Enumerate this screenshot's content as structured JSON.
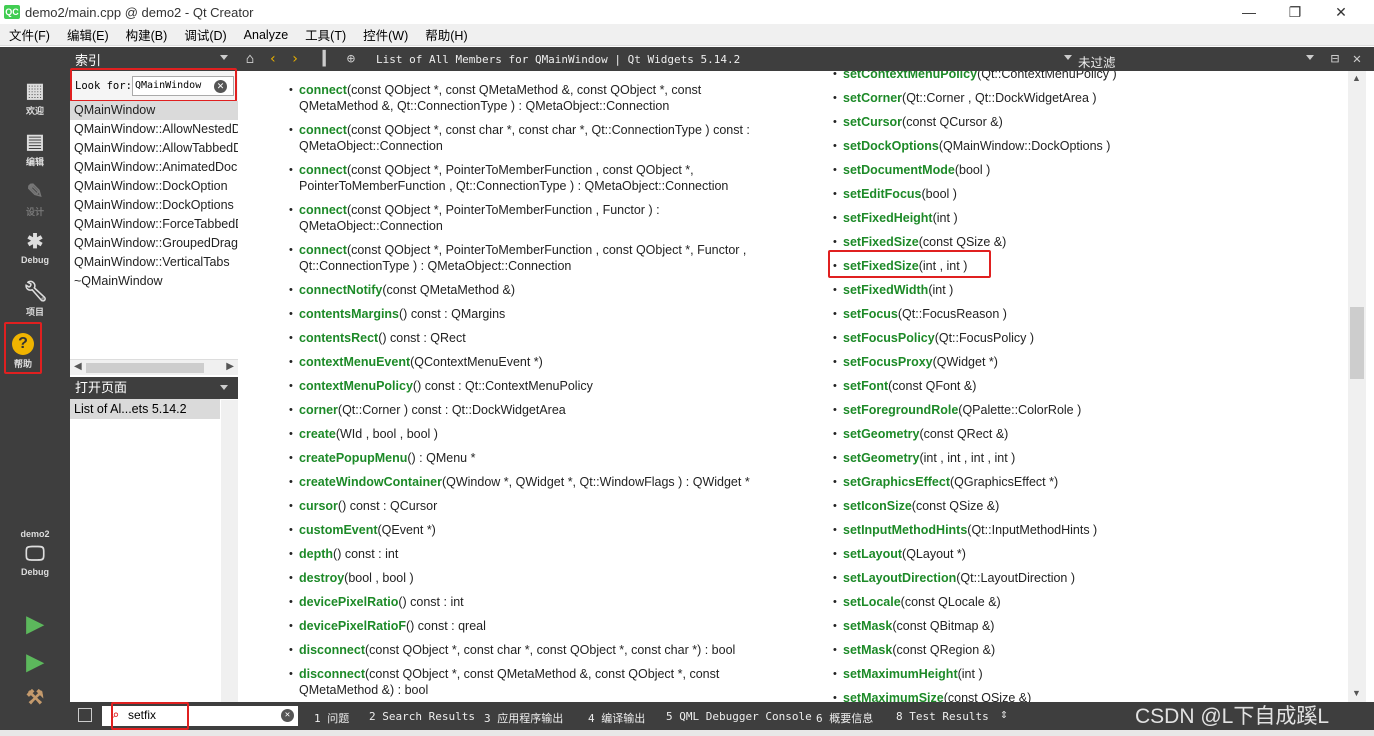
{
  "window": {
    "logo": "QC",
    "title": "demo2/main.cpp @ demo2 - Qt Creator",
    "minimize": "—",
    "maximize": "❐",
    "close": "✕"
  },
  "menu": [
    "文件(F)",
    "编辑(E)",
    "构建(B)",
    "调试(D)",
    "Analyze",
    "工具(T)",
    "控件(W)",
    "帮助(H)"
  ],
  "modes": {
    "welcome": "欢迎",
    "edit": "编辑",
    "design": "设计",
    "debug": "Debug",
    "projects": "项目",
    "help": "帮助",
    "kit_project": "demo2",
    "kit_config": "Debug"
  },
  "sidebar": {
    "index_header": "索引",
    "look_for_label": "Look for:",
    "look_for_value": "QMainWindow",
    "index_items": [
      "QMainWindow",
      "QMainWindow::AllowNestedDocks",
      "QMainWindow::AllowTabbedDocks",
      "QMainWindow::AnimatedDocks",
      "QMainWindow::DockOption",
      "QMainWindow::DockOptions",
      "QMainWindow::ForceTabbedDocks",
      "QMainWindow::GroupedDragging",
      "QMainWindow::VerticalTabs",
      "~QMainWindow"
    ],
    "open_pages_header": "打开页面",
    "open_pages": [
      "List of Al...ets 5.14.2"
    ]
  },
  "help_toolbar": {
    "doc_title": "List of All Members for QMainWindow | Qt Widgets 5.14.2",
    "filter": "未过滤"
  },
  "left_members": [
    {
      "fn": "connect",
      "sig": "(const QObject *, const QMetaMethod &, const QObject *, const",
      "sig2": "QMetaMethod &, Qt::ConnectionType ) : QMetaObject::Connection"
    },
    {
      "fn": "connect",
      "sig": "(const QObject *, const char *, const char *, Qt::ConnectionType ) const :",
      "sig2": "QMetaObject::Connection"
    },
    {
      "fn": "connect",
      "sig": "(const QObject *, PointerToMemberFunction , const QObject *,",
      "sig2": "PointerToMemberFunction , Qt::ConnectionType ) : QMetaObject::Connection"
    },
    {
      "fn": "connect",
      "sig": "(const QObject *, PointerToMemberFunction , Functor ) :",
      "sig2": "QMetaObject::Connection"
    },
    {
      "fn": "connect",
      "sig": "(const QObject *, PointerToMemberFunction , const QObject *, Functor ,",
      "sig2": "Qt::ConnectionType ) : QMetaObject::Connection"
    },
    {
      "fn": "connectNotify",
      "sig": "(const QMetaMethod &)"
    },
    {
      "fn": "contentsMargins",
      "sig": "() const : QMargins"
    },
    {
      "fn": "contentsRect",
      "sig": "() const : QRect"
    },
    {
      "fn": "contextMenuEvent",
      "sig": "(QContextMenuEvent *)"
    },
    {
      "fn": "contextMenuPolicy",
      "sig": "() const : Qt::ContextMenuPolicy"
    },
    {
      "fn": "corner",
      "sig": "(Qt::Corner ) const : Qt::DockWidgetArea"
    },
    {
      "fn": "create",
      "sig": "(WId , bool , bool )"
    },
    {
      "fn": "createPopupMenu",
      "sig": "() : QMenu *"
    },
    {
      "fn": "createWindowContainer",
      "sig": "(QWindow *, QWidget *, Qt::WindowFlags ) : QWidget *"
    },
    {
      "fn": "cursor",
      "sig": "() const : QCursor"
    },
    {
      "fn": "customEvent",
      "sig": "(QEvent *)"
    },
    {
      "fn": "depth",
      "sig": "() const : int"
    },
    {
      "fn": "destroy",
      "sig": "(bool , bool )"
    },
    {
      "fn": "devicePixelRatio",
      "sig": "() const : int"
    },
    {
      "fn": "devicePixelRatioF",
      "sig": "() const : qreal"
    },
    {
      "fn": "disconnect",
      "sig": "(const QObject *, const char *, const QObject *, const char *) : bool"
    },
    {
      "fn": "disconnect",
      "sig": "(const QObject *, const QMetaMethod &, const QObject *, const",
      "sig2": "QMetaMethod &) : bool"
    }
  ],
  "right_members": [
    {
      "fn": "setContextMenuPolicy",
      "sig": "(Qt::ContextMenuPolicy )"
    },
    {
      "fn": "setCorner",
      "sig": "(Qt::Corner , Qt::DockWidgetArea )"
    },
    {
      "fn": "setCursor",
      "sig": "(const QCursor &)"
    },
    {
      "fn": "setDockOptions",
      "sig": "(QMainWindow::DockOptions )"
    },
    {
      "fn": "setDocumentMode",
      "sig": "(bool )"
    },
    {
      "fn": "setEditFocus",
      "sig": "(bool )"
    },
    {
      "fn": "setFixedHeight",
      "sig": "(int )"
    },
    {
      "fn": "setFixedSize",
      "sig": "(const QSize &)"
    },
    {
      "fn": "setFixedSize",
      "sig": "(int , int )"
    },
    {
      "fn": "setFixedWidth",
      "sig": "(int )"
    },
    {
      "fn": "setFocus",
      "sig": "(Qt::FocusReason )"
    },
    {
      "fn": "setFocusPolicy",
      "sig": "(Qt::FocusPolicy )"
    },
    {
      "fn": "setFocusProxy",
      "sig": "(QWidget *)"
    },
    {
      "fn": "setFont",
      "sig": "(const QFont &)"
    },
    {
      "fn": "setForegroundRole",
      "sig": "(QPalette::ColorRole )"
    },
    {
      "fn": "setGeometry",
      "sig": "(const QRect &)"
    },
    {
      "fn": "setGeometry",
      "sig": "(int , int , int , int )"
    },
    {
      "fn": "setGraphicsEffect",
      "sig": "(QGraphicsEffect *)"
    },
    {
      "fn": "setIconSize",
      "sig": "(const QSize &)"
    },
    {
      "fn": "setInputMethodHints",
      "sig": "(Qt::InputMethodHints )"
    },
    {
      "fn": "setLayout",
      "sig": "(QLayout *)"
    },
    {
      "fn": "setLayoutDirection",
      "sig": "(Qt::LayoutDirection )"
    },
    {
      "fn": "setLocale",
      "sig": "(const QLocale &)"
    },
    {
      "fn": "setMask",
      "sig": "(const QBitmap &)"
    },
    {
      "fn": "setMask",
      "sig": "(const QRegion &)"
    },
    {
      "fn": "setMaximumHeight",
      "sig": "(int )"
    },
    {
      "fn": "setMaximumSize",
      "sig": "(const QSize &)"
    }
  ],
  "statusbar": {
    "locator_value": "setfix",
    "tabs": [
      "1 问题",
      "2 Search Results",
      "3 应用程序输出",
      "4 编译输出",
      "5 QML Debugger Console",
      "6 概要信息",
      "8 Test Results"
    ],
    "watermark": "CSDN @L下自成蹊L"
  },
  "colors": {
    "accent_link": "#1d8a28",
    "highlight_box": "#e02020",
    "dark_panel": "#3e3e3e"
  }
}
